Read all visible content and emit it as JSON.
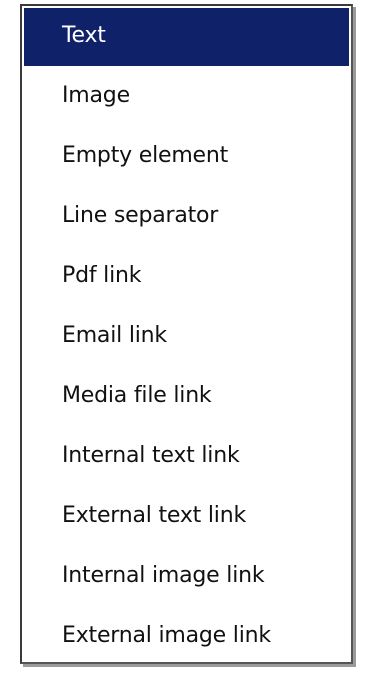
{
  "menu": {
    "selected_color": "#0f2168",
    "items": [
      {
        "label": "Text",
        "selected": true
      },
      {
        "label": "Image",
        "selected": false
      },
      {
        "label": "Empty element",
        "selected": false
      },
      {
        "label": "Line separator",
        "selected": false
      },
      {
        "label": "Pdf link",
        "selected": false
      },
      {
        "label": "Email link",
        "selected": false
      },
      {
        "label": "Media file link",
        "selected": false
      },
      {
        "label": "Internal text link",
        "selected": false
      },
      {
        "label": "External text link",
        "selected": false
      },
      {
        "label": "Internal image link",
        "selected": false
      },
      {
        "label": "External image link",
        "selected": false
      }
    ]
  }
}
